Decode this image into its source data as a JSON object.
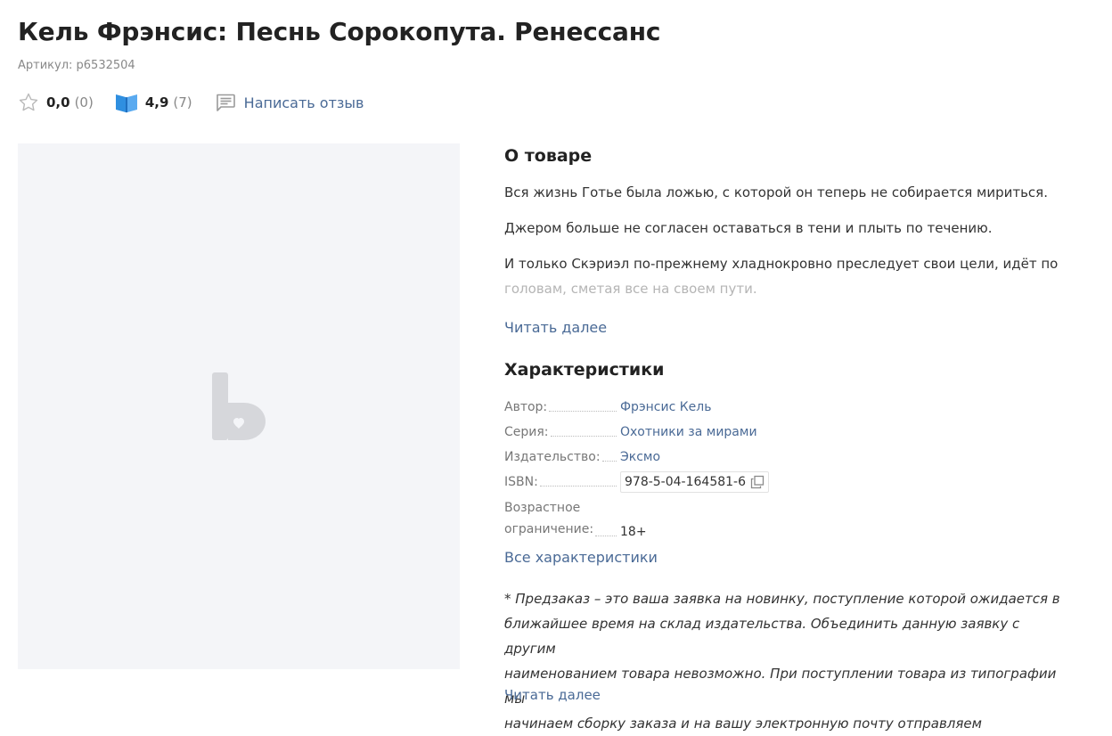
{
  "product": {
    "title": "Кель Фрэнсис: Песнь Сорокопута. Ренессанс",
    "sku": "Артикул: р6532504"
  },
  "ratings": {
    "user_rating": "0,0",
    "user_count": "(0)",
    "book_rating": "4,9",
    "book_count": "(7)",
    "review_link": "Написать отзыв"
  },
  "about": {
    "heading": "О товаре",
    "paragraphs": [
      "Вся жизнь Готье была ложью, с которой он теперь не собирается мириться.",
      "Джером больше не согласен оставаться в тени и плыть по течению.",
      "И только Скэриэл по-прежнему хладнокровно преследует свои цели, идёт по",
      "головам, сметая все на своем пути."
    ],
    "read_more": "Читать далее"
  },
  "characteristics": {
    "heading": "Характеристики",
    "author_label": "Автор:",
    "author_value": "Фрэнсис Кель",
    "series_label": "Серия:",
    "series_value": "Охотники за мирами",
    "publisher_label": "Издательство:",
    "publisher_value": "Эксмо",
    "isbn_label": "ISBN:",
    "isbn_value": "978-5-04-164581-6",
    "age_label_1": "Возрастное",
    "age_label_2": "ограничение:",
    "age_value": "18+",
    "all_link": "Все характеристики"
  },
  "preorder_note": {
    "lines": [
      "* Предзаказ – это ваша заявка на новинку, поступление которой ожидается в",
      "ближайшее время на склад издательства. Объединить данную заявку с другим",
      "наименованием товара невозможно. При поступлении товара из типографии мы",
      "начинаем сборку заказа и на вашу электронную почту отправляем"
    ],
    "read_more": "Читать далее"
  },
  "colors": {
    "link": "#4a6a96",
    "book_icon": "#2f8fe0",
    "image_bg": "#f4f5f8",
    "placeholder_logo": "#d6d7db"
  },
  "icons": {
    "user_rating": "star-outline-icon",
    "book_rating": "open-book-icon",
    "review": "comment-icon",
    "copy": "copy-icon",
    "placeholder": "b-logo-placeholder"
  }
}
